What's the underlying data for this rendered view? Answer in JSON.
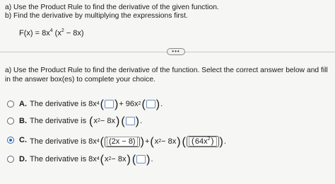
{
  "question": {
    "line_a": "a) Use the Product Rule to find the derivative of the given function.",
    "line_b": "b) Find the derivative by multiplying the expressions first.",
    "function": {
      "lhs": "F(x) = 8x",
      "exp4": "4",
      "open": "(x",
      "exp2": "2",
      "rest": " − 8x)"
    }
  },
  "more_button": "•••",
  "part_a": {
    "instruction": "a) Use the Product Rule to find the derivative of the function. Select the correct answer below and fill in the answer box(es) to complete your choice."
  },
  "options": [
    {
      "letter": "A.",
      "prefix": "The derivative is 8x",
      "exp": "4",
      "middle": " + 96x",
      "exp2": "2",
      "end": ".",
      "selected": false
    },
    {
      "letter": "B.",
      "prefix": "The derivative is ",
      "base": "x",
      "exp": "2",
      "rest": " − 8x",
      "end": ".",
      "selected": false
    },
    {
      "letter": "C.",
      "prefix": "The derivative is 8x",
      "exp": "4",
      "answer1": "(2x − 8)",
      "plus": " + ",
      "base": "x",
      "exp2": "2",
      "rest": " − 8x",
      "answer2_base": "64x",
      "answer2_exp": "2",
      "end": ".",
      "selected": true
    },
    {
      "letter": "D.",
      "prefix": "The derivative is 8x",
      "exp": "4",
      "base": "x",
      "exp2": "2",
      "rest": " − 8x",
      "end": ".",
      "selected": false
    }
  ]
}
